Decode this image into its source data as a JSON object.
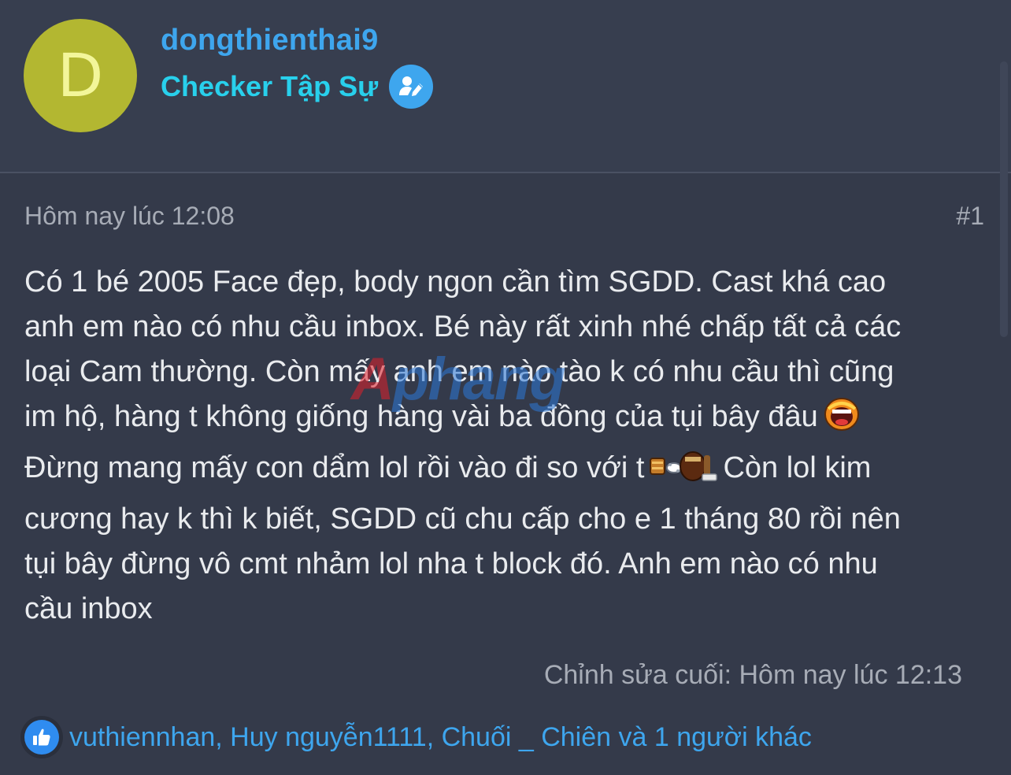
{
  "author": {
    "avatar_letter": "D",
    "avatar_color": "#b3b731",
    "username": "dongthienthai9",
    "rank": "Checker Tập Sự",
    "rank_icon": "user-edit-icon"
  },
  "post": {
    "timestamp": "Hôm nay lúc 12:08",
    "number": "#1",
    "body_lines": [
      "Có 1 bé 2005 Face đẹp, body ngon cần tìm SGDD. Cast khá cao",
      "anh em nào có nhu cầu inbox. Bé này rất xinh nhé chấp tất cả các",
      "loại Cam thường. Còn mấy anh em nào tào k có nhu cầu thì cũng",
      "im hộ, hàng t không giống hàng vài ba đồng của tụi bây đâu",
      "Đừng mang mấy con dẩm lol rồi vào đi so với t",
      "Còn lol kim",
      "cương hay k thì k biết, SGDD cũ chu cấp cho e 1 tháng 80 rồi nên",
      "tụi bây đừng vô cmt nhảm lol nha t block đó. Anh em nào có nhu",
      "cầu inbox"
    ],
    "emoji_1": "shouting-face-emoji",
    "emoji_2": "punch-emoji",
    "edited": "Chỉnh sửa cuối: Hôm nay lúc 12:13"
  },
  "watermark": {
    "first": "A",
    "rest": "phang"
  },
  "reactions": {
    "icon": "like-icon",
    "text": "vuthiennhan, Huy nguyễn1111, Chuối _ Chiên và 1 người khác"
  },
  "colors": {
    "background": "#343a4a",
    "username": "#3ea6ee",
    "rank": "#28d0ec",
    "body_text": "#e9ebee",
    "meta_text": "#a7acb6"
  }
}
